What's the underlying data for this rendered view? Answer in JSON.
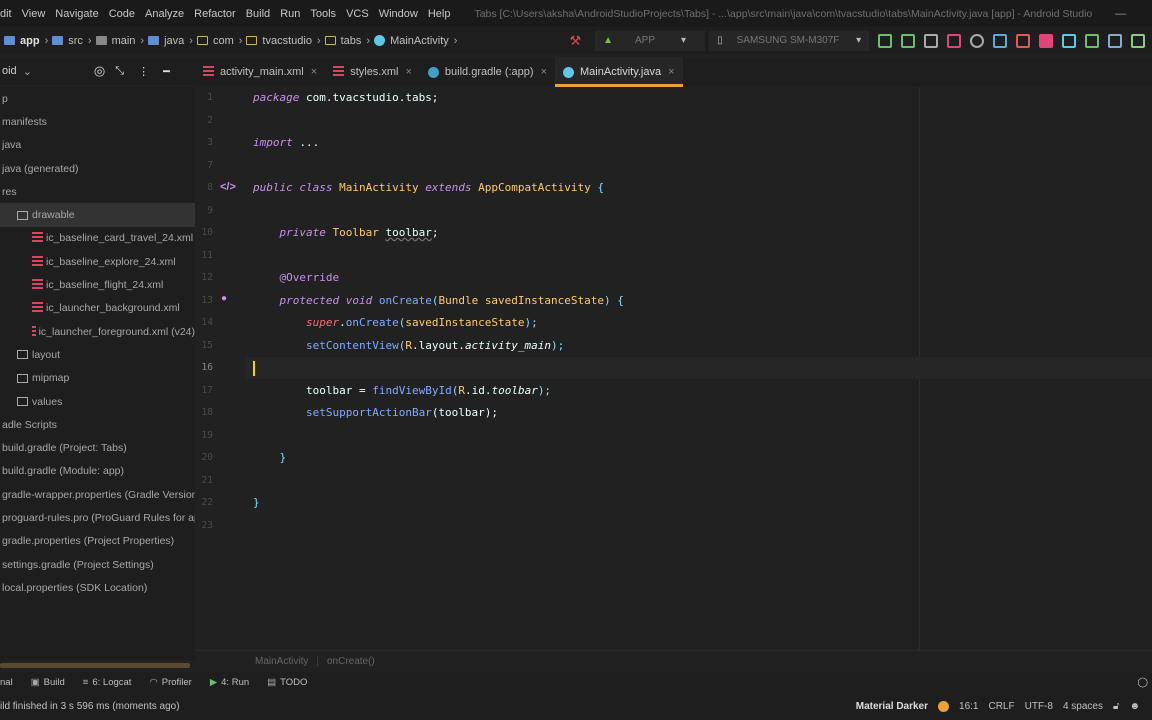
{
  "menu": {
    "items": [
      "dit",
      "View",
      "Navigate",
      "Code",
      "Analyze",
      "Refactor",
      "Build",
      "Run",
      "Tools",
      "VCS",
      "Window",
      "Help"
    ],
    "title": "Tabs [C:\\Users\\aksha\\AndroidStudioProjects\\Tabs] - ...\\app\\src\\main\\java\\com\\tvacstudio\\tabs\\MainActivity.java [app] - Android Studio"
  },
  "nav": {
    "crumbs": [
      "app",
      "src",
      "main",
      "java",
      "com",
      "tvacstudio",
      "tabs",
      "MainActivity"
    ],
    "run_config": "APP",
    "device": "SAMSUNG SM-M307F"
  },
  "project": {
    "view": "oid",
    "tree": [
      {
        "label": "p",
        "indent": 0,
        "icon": "none"
      },
      {
        "label": "manifests",
        "indent": 0,
        "icon": "none"
      },
      {
        "label": "java",
        "indent": 0,
        "icon": "none"
      },
      {
        "label": "java (generated)",
        "indent": 0,
        "icon": "none"
      },
      {
        "label": "res",
        "indent": 0,
        "icon": "none"
      },
      {
        "label": "drawable",
        "indent": 1,
        "icon": "folder",
        "selected": true
      },
      {
        "label": "ic_baseline_card_travel_24.xml",
        "indent": 2,
        "icon": "xml"
      },
      {
        "label": "ic_baseline_explore_24.xml",
        "indent": 2,
        "icon": "xml"
      },
      {
        "label": "ic_baseline_flight_24.xml",
        "indent": 2,
        "icon": "xml"
      },
      {
        "label": "ic_launcher_background.xml",
        "indent": 2,
        "icon": "xml"
      },
      {
        "label": "ic_launcher_foreground.xml (v24)",
        "indent": 2,
        "icon": "xml"
      },
      {
        "label": "layout",
        "indent": 1,
        "icon": "folder"
      },
      {
        "label": "mipmap",
        "indent": 1,
        "icon": "folder"
      },
      {
        "label": "values",
        "indent": 1,
        "icon": "folder"
      },
      {
        "label": "adle Scripts",
        "indent": 0,
        "icon": "none"
      },
      {
        "label": "build.gradle (Project: Tabs)",
        "indent": 0,
        "icon": "none"
      },
      {
        "label": "build.gradle (Module: app)",
        "indent": 0,
        "icon": "none"
      },
      {
        "label": "gradle-wrapper.properties (Gradle Version)",
        "indent": 0,
        "icon": "none"
      },
      {
        "label": "proguard-rules.pro (ProGuard Rules for app)",
        "indent": 0,
        "icon": "none"
      },
      {
        "label": "gradle.properties (Project Properties)",
        "indent": 0,
        "icon": "none"
      },
      {
        "label": "settings.gradle (Project Settings)",
        "indent": 0,
        "icon": "none"
      },
      {
        "label": "local.properties (SDK Location)",
        "indent": 0,
        "icon": "none"
      }
    ]
  },
  "tabs": [
    {
      "label": "activity_main.xml",
      "icon": "xml"
    },
    {
      "label": "styles.xml",
      "icon": "xml"
    },
    {
      "label": "build.gradle (:app)",
      "icon": "gradle"
    },
    {
      "label": "MainActivity.java",
      "icon": "class",
      "active": true
    }
  ],
  "code": [
    {
      "n": "1",
      "tokens": [
        [
          "package",
          "kw"
        ],
        [
          " com.tvacstudio.tabs;",
          "pl"
        ]
      ]
    },
    {
      "n": "2",
      "tokens": []
    },
    {
      "n": "3",
      "tokens": [
        [
          "import",
          "kw"
        ],
        [
          " ...",
          "pl"
        ]
      ]
    },
    {
      "n": "7",
      "tokens": []
    },
    {
      "n": "8",
      "tokens": [
        [
          "public class ",
          "kw"
        ],
        [
          "MainActivity ",
          "cls"
        ],
        [
          "extends ",
          "kw"
        ],
        [
          "AppCompatActivity ",
          "cls"
        ],
        [
          "{",
          "pun"
        ]
      ]
    },
    {
      "n": "9",
      "tokens": []
    },
    {
      "n": "10",
      "tokens": [
        [
          "    private ",
          "kw"
        ],
        [
          "Toolbar ",
          "cls"
        ],
        [
          "toolbar",
          "und"
        ],
        [
          ";",
          "pl"
        ]
      ]
    },
    {
      "n": "11",
      "tokens": []
    },
    {
      "n": "12",
      "tokens": [
        [
          "    @Override",
          "ann"
        ]
      ]
    },
    {
      "n": "13",
      "tokens": [
        [
          "    protected void ",
          "kw"
        ],
        [
          "onCreate",
          "fn"
        ],
        [
          "(",
          "pun"
        ],
        [
          "Bundle ",
          "cls"
        ],
        [
          "savedInstanceState",
          "cls"
        ],
        [
          ") {",
          "pun"
        ]
      ]
    },
    {
      "n": "14",
      "tokens": [
        [
          "        super",
          "sup"
        ],
        [
          ".",
          "pl"
        ],
        [
          "onCreate",
          "fn"
        ],
        [
          "(",
          "pun"
        ],
        [
          "savedInstanceState",
          "cls"
        ],
        [
          ");",
          "pun"
        ]
      ]
    },
    {
      "n": "15",
      "tokens": [
        [
          "        setContentView",
          "fn"
        ],
        [
          "(",
          "pun"
        ],
        [
          "R",
          "cls"
        ],
        [
          ".layout.",
          "pl"
        ],
        [
          "activity_main",
          "fld"
        ],
        [
          ");",
          "pun"
        ]
      ]
    },
    {
      "n": "16",
      "tokens": []
    },
    {
      "n": "17",
      "tokens": [
        [
          "        toolbar = ",
          "pl"
        ],
        [
          "findViewById",
          "fn"
        ],
        [
          "(",
          "pun"
        ],
        [
          "R",
          "cls"
        ],
        [
          ".id.",
          "pl"
        ],
        [
          "toolbar",
          "fld"
        ],
        [
          ");",
          "pun"
        ]
      ]
    },
    {
      "n": "18",
      "tokens": [
        [
          "        setSupportActionBar",
          "fn"
        ],
        [
          "(toolbar);",
          "pl"
        ]
      ]
    },
    {
      "n": "19",
      "tokens": []
    },
    {
      "n": "20",
      "tokens": [
        [
          "    }",
          "pun"
        ]
      ]
    },
    {
      "n": "21",
      "tokens": []
    },
    {
      "n": "22",
      "tokens": [
        [
          "}",
          "pun"
        ]
      ]
    },
    {
      "n": "23",
      "tokens": []
    }
  ],
  "editor_breadcrumb": [
    "MainActivity",
    "onCreate()"
  ],
  "tool_windows": [
    "nal",
    "Build",
    "6: Logcat",
    "Profiler",
    "4: Run",
    "TODO"
  ],
  "status": {
    "message": "ild finished in 3 s 596 ms (moments ago)",
    "theme": "Material Darker",
    "position": "16:1",
    "line_sep": "CRLF",
    "encoding": "UTF-8",
    "indent": "4 spaces"
  },
  "colors": {
    "accent": "#f0a030",
    "keyword": "#c792ea",
    "class": "#ffcb6b",
    "function": "#82aaff"
  }
}
